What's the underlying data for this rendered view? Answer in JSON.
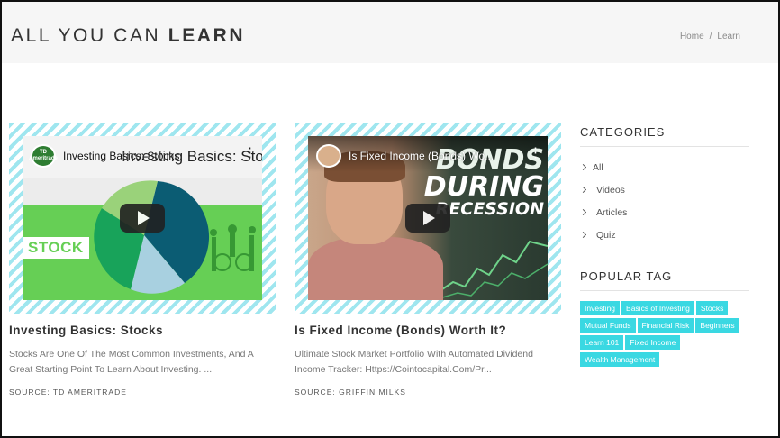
{
  "header": {
    "title_light": "ALL YOU CAN",
    "title_bold": "LEARN",
    "breadcrumb": [
      "Home",
      "Learn"
    ],
    "breadcrumb_separator": "/"
  },
  "cards": [
    {
      "video_title": "Investing Basics: Stocks",
      "video_channel": "TD Ameritrade",
      "video_bg_text": "Investing Basics: Sto",
      "video_overlay_text": "STOCK",
      "title": "Investing Basics: Stocks",
      "description": "Stocks Are One Of The Most Common Investments, And A Great Starting Point To Learn About Investing. ...",
      "source": "SOURCE: TD AMERITRADE"
    },
    {
      "video_title": "Is Fixed Income (Bonds) Wo...",
      "video_overlay_lines": [
        "BONDS",
        "DURING",
        "RECESSION"
      ],
      "title": "Is Fixed Income (Bonds) Worth It?",
      "description": "Ultimate Stock Market Portfolio With Automated Dividend Income Tracker: Https://Cointocapital.Com/Pr...",
      "source": "SOURCE: GRIFFIN MILKS"
    }
  ],
  "sidebar": {
    "categories_heading": "CATEGORIES",
    "categories": [
      "All",
      "Videos",
      "Articles",
      "Quiz"
    ],
    "popular_heading": "POPULAR TAG",
    "tags": [
      "Investing",
      "Basics of Investing",
      "Stocks",
      "Mutual Funds",
      "Financial Risk",
      "Beginners",
      "Learn 101",
      "Fixed Income",
      "Wealth Management"
    ]
  },
  "colors": {
    "tag_bg": "#3ad8e2",
    "hatch": "#9fe6ef",
    "stock_green": "#66cf55"
  }
}
